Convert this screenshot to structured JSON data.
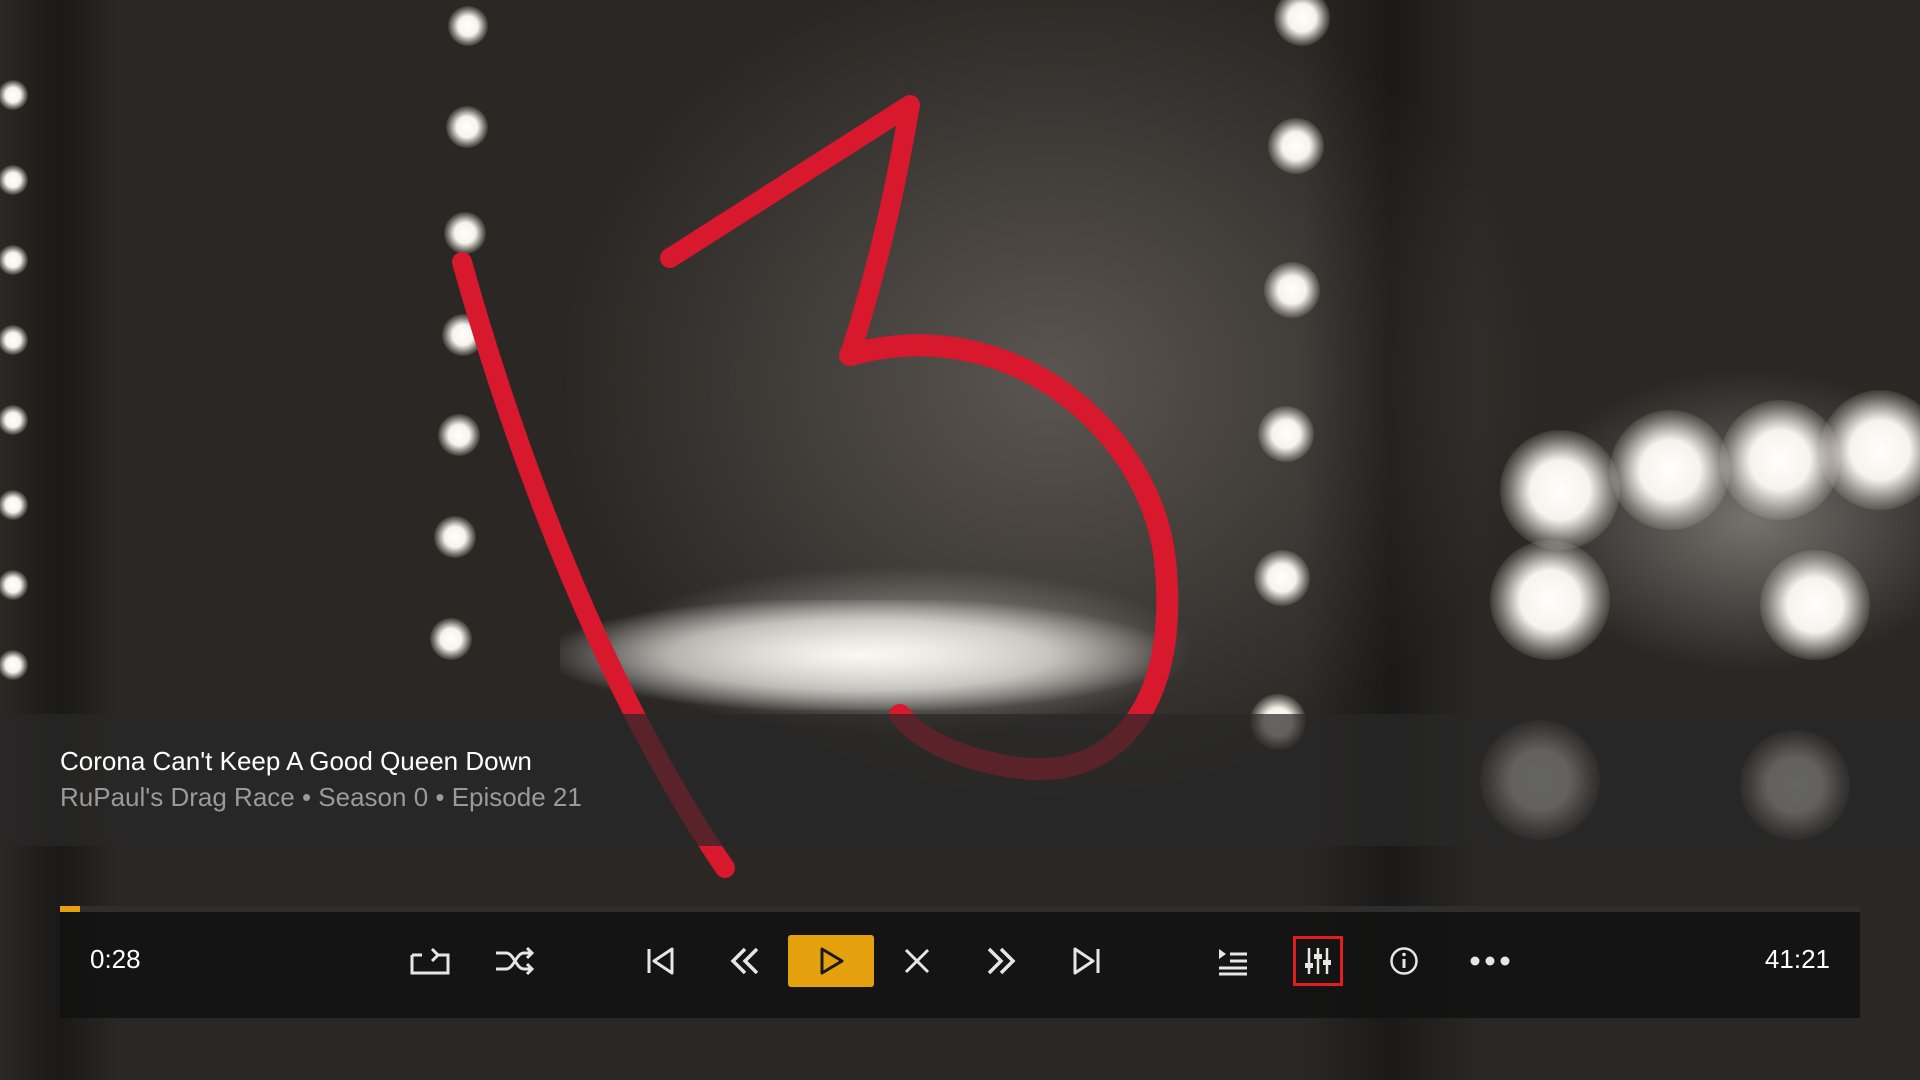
{
  "media": {
    "title": "Corona Can't Keep A Good Queen Down",
    "subtitle": "RuPaul's Drag Race • Season 0 • Episode 21"
  },
  "player": {
    "elapsed": "0:28",
    "duration": "41:21",
    "progress_fraction": 0.011,
    "controls": [
      {
        "name": "repeat-button",
        "icon": "repeat-icon"
      },
      {
        "name": "shuffle-button",
        "icon": "shuffle-icon"
      },
      {
        "name": "previous-button",
        "icon": "skip-previous-icon"
      },
      {
        "name": "rewind-button",
        "icon": "rewind-icon"
      },
      {
        "name": "play-button",
        "icon": "play-icon"
      },
      {
        "name": "stop-button",
        "icon": "close-icon"
      },
      {
        "name": "fast-forward-button",
        "icon": "fast-forward-icon"
      },
      {
        "name": "next-button",
        "icon": "skip-next-icon"
      },
      {
        "name": "play-queue-button",
        "icon": "playlist-icon"
      },
      {
        "name": "audio-settings-button",
        "icon": "sliders-icon",
        "focused": true
      },
      {
        "name": "info-button",
        "icon": "info-icon"
      },
      {
        "name": "more-button",
        "icon": "more-icon"
      }
    ]
  },
  "colors": {
    "accent": "#e5a00d",
    "focus_outline": "#e31d1d",
    "lipstick": "#d8182c"
  },
  "background": {
    "scene": "dressing-room mirror with vanity bulbs",
    "lipstick_text": "13"
  }
}
